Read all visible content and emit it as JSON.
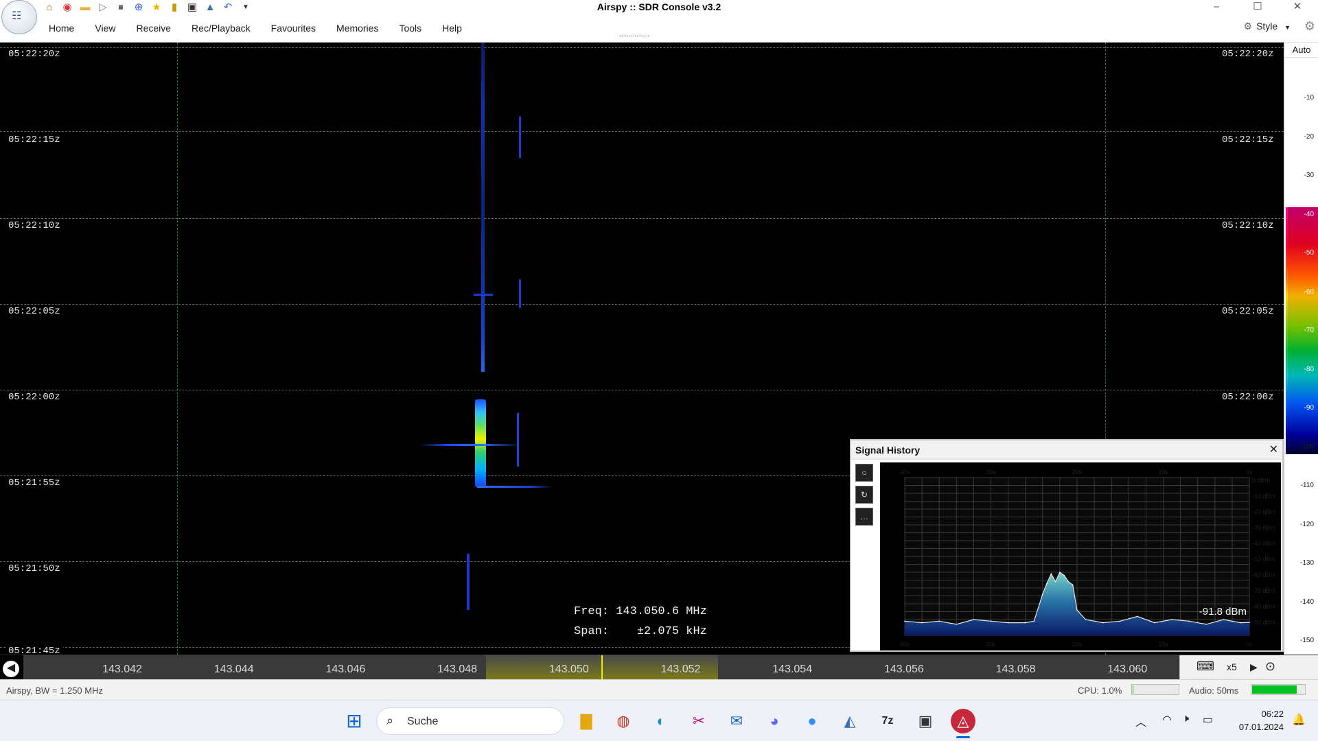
{
  "app": {
    "title": "Airspy :: SDR Console v3.2",
    "quick_access_icons": [
      "home-icon",
      "lifebuoy-icon",
      "folder-icon",
      "play-icon",
      "stop-icon",
      "plus-icon",
      "star-icon",
      "lock-icon",
      "camera-icon",
      "flask-icon",
      "undo-icon",
      "dropdown-arrow-icon"
    ],
    "window_controls": [
      "minimize",
      "maximize",
      "close"
    ]
  },
  "menu": {
    "tabs": [
      "Home",
      "View",
      "Receive",
      "Rec/Playback",
      "Favourites",
      "Memories",
      "Tools",
      "Help"
    ],
    "dots": "................",
    "style_label": "Style"
  },
  "waterfall": {
    "time_labels": [
      "05:22:20z",
      "05:22:15z",
      "05:22:10z",
      "05:22:05z",
      "05:22:00z",
      "05:21:55z",
      "05:21:50z",
      "05:21:45z"
    ],
    "info": {
      "freq_label": "Freq:",
      "freq_value": "143.050.6 MHz",
      "span_label": "Span:",
      "span_value": "±2.075 kHz"
    }
  },
  "scale": {
    "mode": "Auto",
    "ticks": [
      "-10",
      "-20",
      "-30",
      "-40",
      "-50",
      "-60",
      "-70",
      "-80",
      "-90",
      "-100",
      "-110",
      "-120",
      "-130",
      "-140",
      "-150"
    ]
  },
  "freq_axis": {
    "labels": [
      "143.042",
      "143.044",
      "143.046",
      "143.048",
      "143.050",
      "143.052",
      "143.054",
      "143.056",
      "143.058",
      "143.060"
    ],
    "zoom": "x5"
  },
  "status": {
    "device": "Airspy, BW = 1.250 MHz",
    "cpu": "CPU: 1.0%",
    "cpu_level": 0.01,
    "audio": "Audio: 50ms",
    "audio_level": 0.85
  },
  "signal_history": {
    "title": "Signal History",
    "time_ticks": [
      "40s",
      "30s",
      "20s",
      "10s",
      "0s"
    ],
    "dbm_ticks": [
      "0 dBm",
      "-10 dBm",
      "-20 dBm",
      "-30 dBm",
      "-40 dBm",
      "-50 dBm",
      "-60 dBm",
      "-70 dBm",
      "-80 dBm",
      "-90 dBm"
    ],
    "current": "-91.8 dBm"
  },
  "chart_data": {
    "type": "area",
    "title": "Signal History",
    "xlabel": "",
    "ylabel": "",
    "x_unit": "s ago",
    "xlim": [
      40,
      0
    ],
    "ylim": [
      -100,
      0
    ],
    "x": [
      40,
      38,
      36,
      34,
      32,
      30,
      28,
      26,
      25,
      24,
      23.5,
      23,
      22.5,
      22,
      21.5,
      21,
      20.5,
      20,
      19,
      17,
      15,
      13,
      11,
      9,
      7,
      5,
      3,
      1,
      0
    ],
    "series": [
      {
        "values": [
          -91,
          -92,
          -91,
          -93,
          -90,
          -91,
          -92,
          -92,
          -91,
          -74,
          -67,
          -61,
          -66,
          -60,
          -62,
          -66,
          -68,
          -84,
          -90,
          -92,
          -91,
          -88,
          -92,
          -90,
          -91,
          -93,
          -90,
          -92,
          -91.8
        ]
      }
    ]
  },
  "taskbar": {
    "search_placeholder": "Suche",
    "apps": [
      "windows-start-icon",
      "file-explorer-icon",
      "chrome-icon",
      "edge-icon",
      "snipping-tool-icon",
      "mail-icon",
      "discord-icon",
      "zoom-icon",
      "sdr-console-icon",
      "7zip-icon",
      "camera-app-icon",
      "airspy-icon"
    ],
    "time": "06:22",
    "date": "07.01.2024"
  }
}
